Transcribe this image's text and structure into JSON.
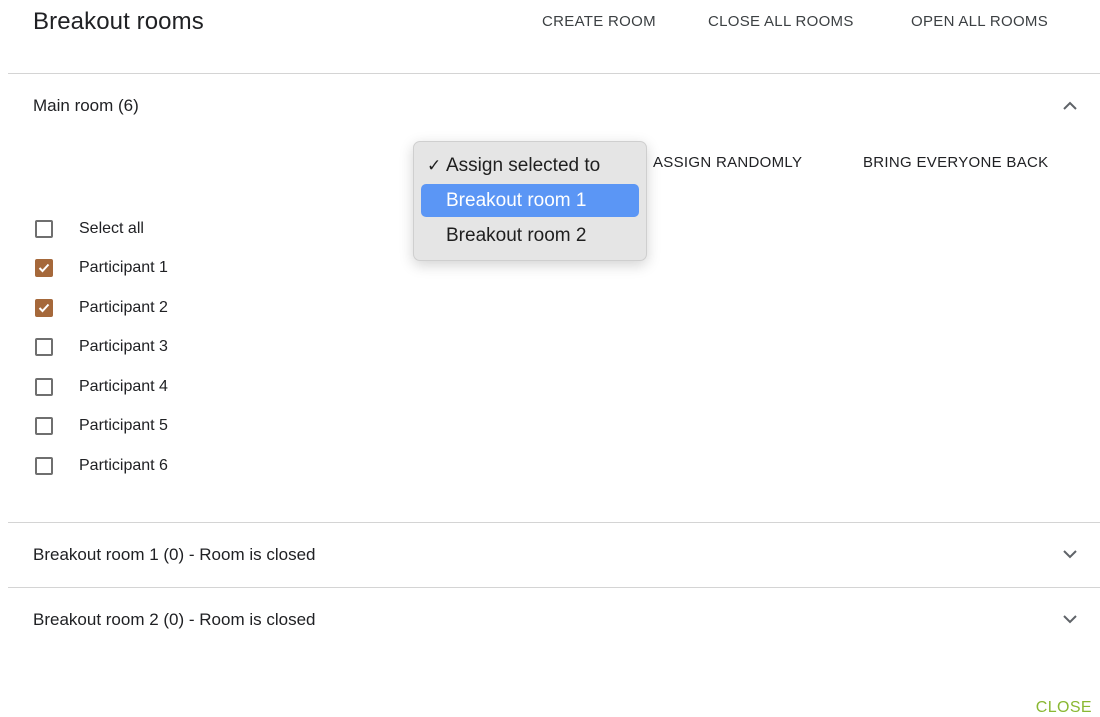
{
  "dialog": {
    "title": "Breakout rooms",
    "actions": {
      "create_room": "CREATE ROOM",
      "close_all": "CLOSE ALL ROOMS",
      "open_all": "OPEN ALL ROOMS"
    },
    "close_label": "CLOSE"
  },
  "main_room": {
    "label": "Main room (6)",
    "expanded": true,
    "assign_dropdown": {
      "selected_label": "Assign selected to",
      "options": [
        "Breakout room 1",
        "Breakout room 2"
      ],
      "highlighted": "Breakout room 1"
    },
    "assign_randomly": "ASSIGN RANDOMLY",
    "bring_back": "BRING EVERYONE BACK",
    "select_all": "Select all",
    "participants": [
      {
        "name": "Participant 1",
        "checked": true
      },
      {
        "name": "Participant 2",
        "checked": true
      },
      {
        "name": "Participant 3",
        "checked": false
      },
      {
        "name": "Participant 4",
        "checked": false
      },
      {
        "name": "Participant 5",
        "checked": false
      },
      {
        "name": "Participant 6",
        "checked": false
      }
    ]
  },
  "breakout_rooms": [
    {
      "label": "Breakout room 1 (0) - Room is closed",
      "expanded": false
    },
    {
      "label": "Breakout room 2 (0) - Room is closed",
      "expanded": false
    }
  ],
  "colors": {
    "checkbox_checked": "#a5683a",
    "dropdown_highlight": "#5b96f5",
    "close_button": "#8ab833"
  }
}
